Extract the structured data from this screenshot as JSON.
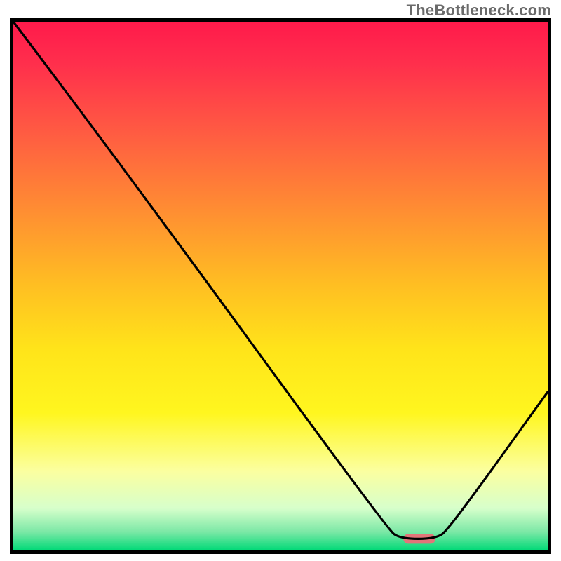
{
  "watermark": "TheBottleneck.com",
  "chart_data": {
    "type": "line",
    "title": "",
    "xlabel": "",
    "ylabel": "",
    "xlim": [
      0,
      100
    ],
    "ylim": [
      0,
      100
    ],
    "series": [
      {
        "name": "curve",
        "stroke": "#000000",
        "points": [
          {
            "x": 0,
            "y": 100
          },
          {
            "x": 18,
            "y": 76
          },
          {
            "x": 70,
            "y": 4
          },
          {
            "x": 72.5,
            "y": 2.2
          },
          {
            "x": 79,
            "y": 2.2
          },
          {
            "x": 81.5,
            "y": 4
          },
          {
            "x": 100,
            "y": 30
          }
        ]
      }
    ],
    "marker": {
      "name": "highlight-bar",
      "x_start": 73,
      "x_end": 79,
      "y": 2.2,
      "fill": "#e27579"
    },
    "gradient_stops": [
      {
        "offset": 0.0,
        "color": "#ff1a4b"
      },
      {
        "offset": 0.08,
        "color": "#ff2f4c"
      },
      {
        "offset": 0.2,
        "color": "#ff5843"
      },
      {
        "offset": 0.35,
        "color": "#ff8b33"
      },
      {
        "offset": 0.5,
        "color": "#ffbf22"
      },
      {
        "offset": 0.62,
        "color": "#ffe41a"
      },
      {
        "offset": 0.74,
        "color": "#fff61f"
      },
      {
        "offset": 0.85,
        "color": "#fbffa0"
      },
      {
        "offset": 0.92,
        "color": "#d7ffcb"
      },
      {
        "offset": 0.965,
        "color": "#7be8a6"
      },
      {
        "offset": 1.0,
        "color": "#00d977"
      }
    ],
    "axis_color": "#000000",
    "axis_width": 5
  }
}
